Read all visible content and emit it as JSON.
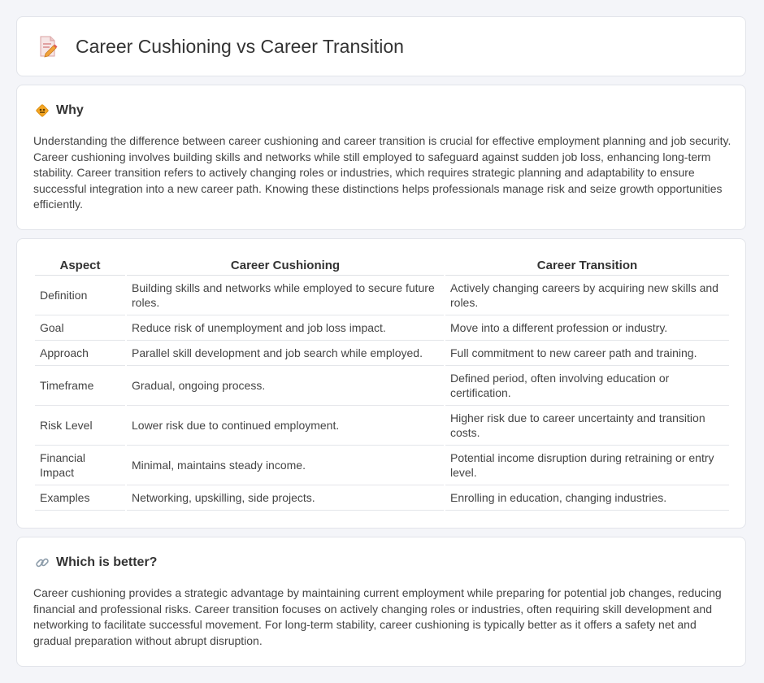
{
  "header": {
    "title": "Career Cushioning vs Career Transition",
    "icon": "document-pencil-icon"
  },
  "why": {
    "title": "Why",
    "icon": "diamond-sign-icon",
    "text": "Understanding the difference between career cushioning and career transition is crucial for effective employment planning and job security. Career cushioning involves building skills and networks while still employed to safeguard against sudden job loss, enhancing long-term stability. Career transition refers to actively changing roles or industries, which requires strategic planning and adaptability to ensure successful integration into a new career path. Knowing these distinctions helps professionals manage risk and seize growth opportunities efficiently."
  },
  "table": {
    "headers": [
      "Aspect",
      "Career Cushioning",
      "Career Transition"
    ],
    "rows": [
      [
        "Definition",
        "Building skills and networks while employed to secure future roles.",
        "Actively changing careers by acquiring new skills and roles."
      ],
      [
        "Goal",
        "Reduce risk of unemployment and job loss impact.",
        "Move into a different profession or industry."
      ],
      [
        "Approach",
        "Parallel skill development and job search while employed.",
        "Full commitment to new career path and training."
      ],
      [
        "Timeframe",
        "Gradual, ongoing process.",
        "Defined period, often involving education or certification."
      ],
      [
        "Risk Level",
        "Lower risk due to continued employment.",
        "Higher risk due to career uncertainty and transition costs."
      ],
      [
        "Financial Impact",
        "Minimal, maintains steady income.",
        "Potential income disruption during retraining or entry level."
      ],
      [
        "Examples",
        "Networking, upskilling, side projects.",
        "Enrolling in education, changing industries."
      ]
    ]
  },
  "better": {
    "title": "Which is better?",
    "icon": "link-icon",
    "text": "Career cushioning provides a strategic advantage by maintaining current employment while preparing for potential job changes, reducing financial and professional risks. Career transition focuses on actively changing roles or industries, often requiring skill development and networking to facilitate successful movement. For long-term stability, career cushioning is typically better as it offers a safety net and gradual preparation without abrupt disruption."
  }
}
